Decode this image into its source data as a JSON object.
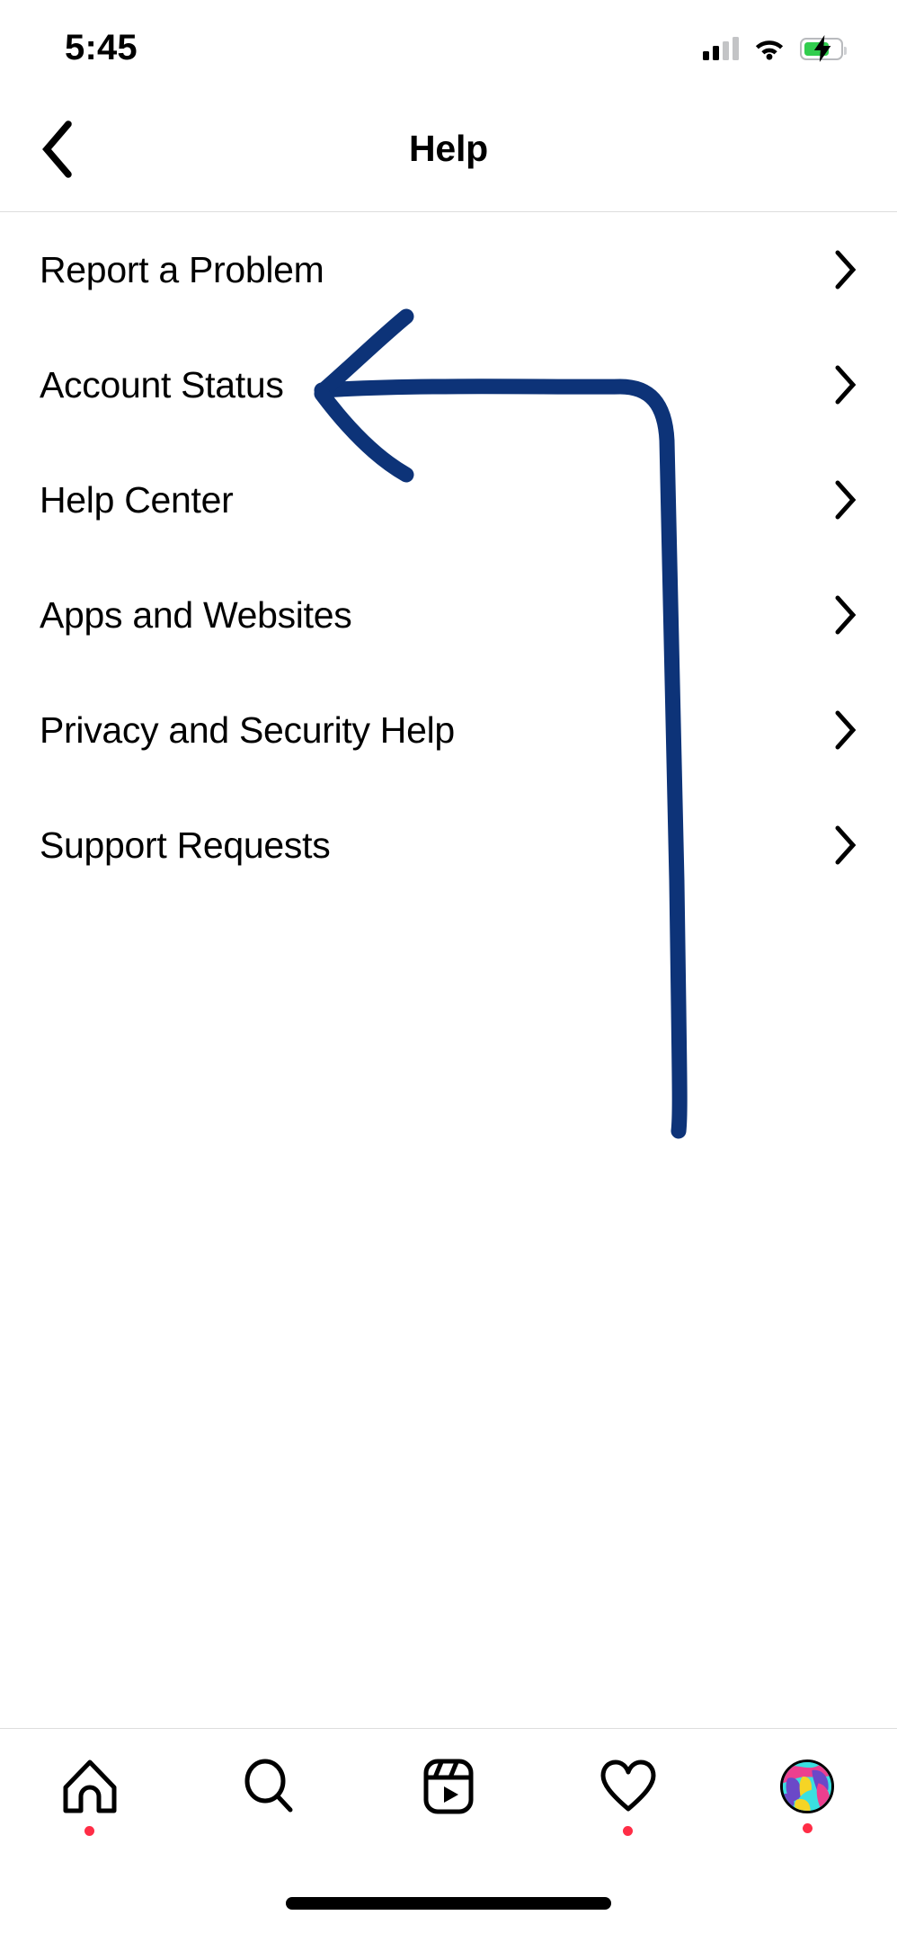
{
  "status_bar": {
    "time": "5:45",
    "cellular_icon": "cellular-signal-icon",
    "cellular_bars_filled": 2,
    "cellular_bars_total": 4,
    "wifi_icon": "wifi-icon",
    "battery_icon": "battery-charging-icon",
    "battery_level_percent": 62,
    "battery_color": "#32cd4e",
    "battery_charging": true
  },
  "header": {
    "back_icon": "chevron-left-icon",
    "title": "Help"
  },
  "menu": {
    "chevron_icon": "chevron-right-icon",
    "items": [
      {
        "label": "Report a Problem"
      },
      {
        "label": "Account Status"
      },
      {
        "label": "Help Center"
      },
      {
        "label": "Apps and Websites"
      },
      {
        "label": "Privacy and Security Help"
      },
      {
        "label": "Support Requests"
      }
    ]
  },
  "annotation": {
    "type": "hand-drawn-arrow",
    "color": "#0d3378",
    "points_to": "Account Status",
    "description": "Dark navy hand-drawn arrow pointing left toward the Account Status row, with a long tail running right then curving down the page."
  },
  "tabbar": {
    "tabs": [
      {
        "name": "home",
        "icon": "home-icon",
        "badge": true
      },
      {
        "name": "search",
        "icon": "search-icon",
        "badge": false
      },
      {
        "name": "reels",
        "icon": "reels-icon",
        "badge": false
      },
      {
        "name": "activity",
        "icon": "heart-icon",
        "badge": true
      },
      {
        "name": "profile",
        "icon": "avatar-icon",
        "badge": true
      }
    ],
    "badge_color": "#ff2d46"
  },
  "home_indicator": {
    "icon": "home-indicator-bar"
  }
}
